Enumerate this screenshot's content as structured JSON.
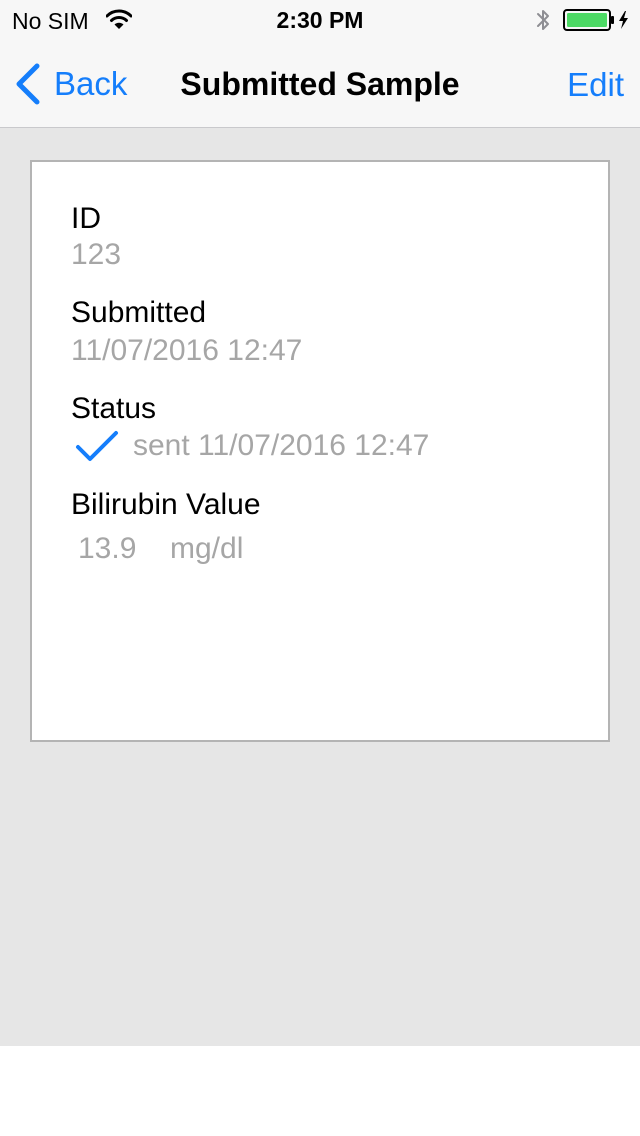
{
  "status_bar": {
    "carrier": "No SIM",
    "time": "2:30 PM",
    "battery_color": "#4cd964"
  },
  "nav": {
    "back_label": "Back",
    "title": "Submitted Sample",
    "edit_label": "Edit",
    "accent_color": "#157efb"
  },
  "sample": {
    "id_label": "ID",
    "id_value": "123",
    "submitted_label": "Submitted",
    "submitted_value": "11/07/2016 12:47",
    "status_label": "Status",
    "status_icon": "checkmark-icon",
    "status_value": "sent 11/07/2016 12:47",
    "bilirubin_label": "Bilirubin Value",
    "bilirubin_value": "13.9",
    "bilirubin_unit": "mg/dl"
  }
}
